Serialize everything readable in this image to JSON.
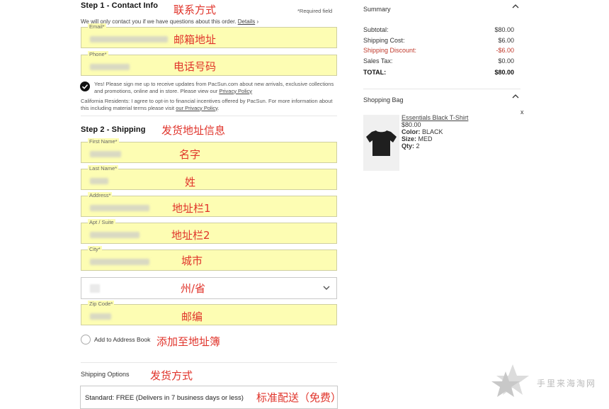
{
  "step1": {
    "title": "Step 1 - Contact Info",
    "required_note": "*Required field",
    "contact_note": "We will only contact you if we have questions about this order.",
    "details_link": "Details",
    "details_arrow": "›",
    "email_label": "Email*",
    "phone_label": "Phone*",
    "opt_in_text": "Yes! Please sign me up to receive updates from PacSun.com about new arrivals, exclusive collections and promotions, online and in store. Please view our",
    "privacy_link": "Privacy Policy",
    "california_text": "California Residents: I agree to opt-in to financial incentives offered by PacSun. For more information about this including material terms please visit",
    "california_link": "our Privacy Policy",
    "california_end": "."
  },
  "step2": {
    "title": "Step 2 - Shipping",
    "first_name_label": "First Name*",
    "last_name_label": "Last Name*",
    "address_label": "Address*",
    "apt_label": "Apt / Suite",
    "city_label": "City*",
    "zip_label": "Zip Code*",
    "add_to_address_book": "Add to Address Book",
    "shipping_options_label": "Shipping Options",
    "shipping_option_value": "Standard: FREE (Delivers in 7 business days or less)"
  },
  "annotations": {
    "contact": "联系方式",
    "email": "邮箱地址",
    "phone": "电话号码",
    "shipping_info": "发货地址信息",
    "first_name": "名字",
    "last_name": "姓",
    "address1": "地址栏1",
    "address2": "地址栏2",
    "city": "城市",
    "state": "州/省",
    "zip": "邮编",
    "address_book": "添加至地址簿",
    "shipping_method": "发货方式",
    "standard_free": "标准配送（免费）"
  },
  "summary": {
    "title": "Summary",
    "rows": [
      {
        "label": "Subtotal:",
        "value": "$80.00"
      },
      {
        "label": "Shipping Cost:",
        "value": "$6.00"
      },
      {
        "label": "Shipping Discount:",
        "value": "-$6.00"
      },
      {
        "label": "Sales Tax:",
        "value": "$0.00"
      }
    ],
    "total_label": "TOTAL:",
    "total_value": "$80.00"
  },
  "bag": {
    "title": "Shopping Bag",
    "remove": "x",
    "item": {
      "name": "Essentials Black T-Shirt",
      "price": "$80.00",
      "color_label": "Color:",
      "color": "BLACK",
      "size_label": "Size:",
      "size": "MED",
      "qty_label": "Qty:",
      "qty": "2"
    }
  },
  "watermark": "手里来海淘网"
}
